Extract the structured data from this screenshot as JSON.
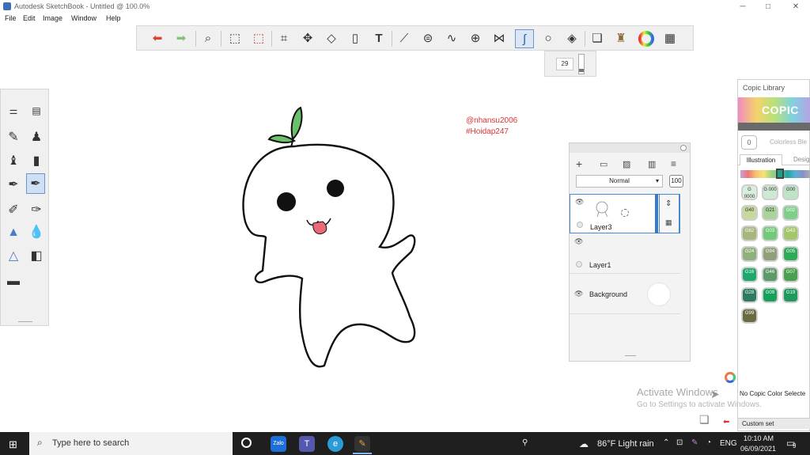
{
  "window": {
    "title": "Autodesk SketchBook - Untitled @ 100.0%",
    "min": "─",
    "max": "□",
    "close": "✕"
  },
  "menu": [
    "File",
    "Edit",
    "Image",
    "Window",
    "Help"
  ],
  "toolbar": {
    "undo": "undo-icon",
    "redo": "redo-icon",
    "zoom": "zoom-icon",
    "brush_size": "29"
  },
  "canvas": {
    "watermark_user": "@nhansu2006",
    "watermark_site": "#Hoidap247"
  },
  "layers": {
    "blend_mode": "Normal",
    "opacity": "100",
    "items": [
      {
        "name": "Layer3"
      },
      {
        "name": "Layer1"
      },
      {
        "name": "Background"
      }
    ]
  },
  "copic": {
    "title": "Copic Library",
    "logo": "COPIC",
    "colorless_count": "0",
    "colorless_label": "Colorless Ble",
    "tabs": [
      "Illustration",
      "Desig"
    ],
    "swatches": [
      {
        "code": "G 0000",
        "color": "#d9eedd"
      },
      {
        "code": "G 000",
        "color": "#cde9d2"
      },
      {
        "code": "G00",
        "color": "#bfe3c6"
      },
      {
        "code": "G40",
        "color": "#c7d89c"
      },
      {
        "code": "G21",
        "color": "#a9d39b"
      },
      {
        "code": "G02",
        "color": "#7fcf8a"
      },
      {
        "code": "G82",
        "color": "#a7b67a"
      },
      {
        "code": "G03",
        "color": "#6fcb7a"
      },
      {
        "code": "G43",
        "color": "#a3c76a"
      },
      {
        "code": "G24",
        "color": "#8fb07b"
      },
      {
        "code": "G94",
        "color": "#8fa07a"
      },
      {
        "code": "G05",
        "color": "#2eaa5a"
      },
      {
        "code": "G16",
        "color": "#1ea86b"
      },
      {
        "code": "G46",
        "color": "#5d9a69"
      },
      {
        "code": "G07",
        "color": "#4aa04f"
      },
      {
        "code": "G28",
        "color": "#2e7b60"
      },
      {
        "code": "G09",
        "color": "#16a15a"
      },
      {
        "code": "G19",
        "color": "#1d9a5c"
      },
      {
        "code": "G99",
        "color": "#6b6a40"
      }
    ],
    "status": "No Copic Color Selecte",
    "custom_set": "Custom set"
  },
  "activation": {
    "title": "Activate Windows",
    "subtitle": "Go to Settings to activate Windows."
  },
  "taskbar": {
    "search_placeholder": "Type here to search",
    "weather": "86°F  Light rain",
    "language": "ENG",
    "time": "10:10 AM",
    "date": "06/09/2021",
    "notifications": "9"
  },
  "colors": {
    "accent": "#3b78c2",
    "toolbar_bg": "#f0f0f0",
    "taskbar": "#1f1f1f"
  }
}
